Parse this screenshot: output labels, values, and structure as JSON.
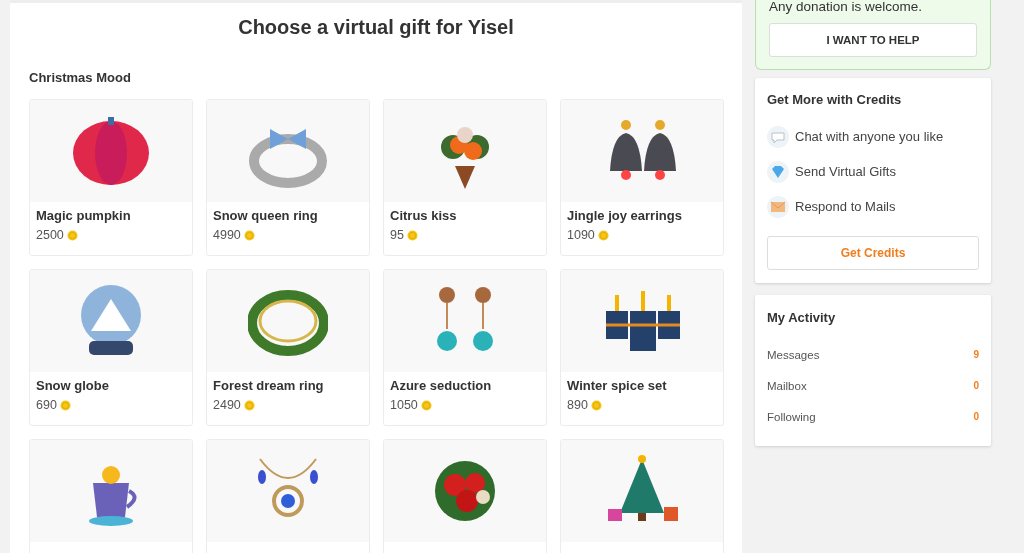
{
  "page_title": "Choose a virtual gift for Yisel",
  "section": {
    "title": "Christmas Mood",
    "gifts": [
      {
        "name": "Magic pumpkin",
        "price": "2500"
      },
      {
        "name": "Snow queen ring",
        "price": "4990"
      },
      {
        "name": "Citrus kiss",
        "price": "95"
      },
      {
        "name": "Jingle joy earrings",
        "price": "1090"
      },
      {
        "name": "Snow globe",
        "price": "690"
      },
      {
        "name": "Forest dream ring",
        "price": "2490"
      },
      {
        "name": "Azure seduction",
        "price": "1050"
      },
      {
        "name": "Winter spice set",
        "price": "890"
      }
    ]
  },
  "donation": {
    "text": "Any donation is welcome.",
    "button": "I WANT TO HELP"
  },
  "credits": {
    "title": "Get More with Credits",
    "features": [
      {
        "label": "Chat with anyone you like"
      },
      {
        "label": "Send Virtual Gifts"
      },
      {
        "label": "Respond to Mails"
      }
    ],
    "button": "Get Credits"
  },
  "activity": {
    "title": "My Activity",
    "items": [
      {
        "label": "Messages",
        "count": "9"
      },
      {
        "label": "Mailbox",
        "count": "0"
      },
      {
        "label": "Following",
        "count": "0"
      }
    ]
  }
}
